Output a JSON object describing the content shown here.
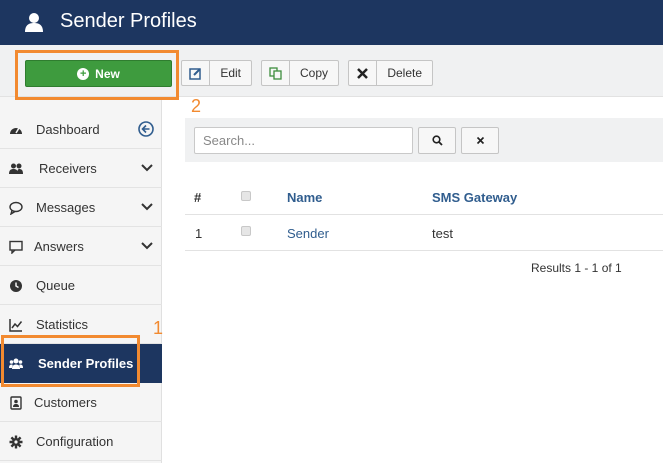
{
  "header": {
    "title": "Sender Profiles",
    "icon": "user-icon"
  },
  "toolbar": {
    "new_label": "New",
    "edit_label": "Edit",
    "copy_label": "Copy",
    "delete_label": "Delete"
  },
  "annotations": {
    "one": "1",
    "two": "2"
  },
  "sidebar": {
    "items": [
      {
        "label": "Dashboard",
        "icon": "dashboard-icon"
      },
      {
        "label": "Receivers",
        "icon": "users-icon"
      },
      {
        "label": "Messages",
        "icon": "message-icon"
      },
      {
        "label": "Answers",
        "icon": "answer-icon"
      },
      {
        "label": "Queue",
        "icon": "clock-icon"
      },
      {
        "label": "Statistics",
        "icon": "chart-icon"
      },
      {
        "label": "Sender Profiles",
        "icon": "group-icon"
      },
      {
        "label": "Customers",
        "icon": "contact-icon"
      },
      {
        "label": "Configuration",
        "icon": "gear-icon"
      }
    ]
  },
  "search": {
    "placeholder": "Search..."
  },
  "table": {
    "columns": [
      "#",
      "Name",
      "SMS Gateway"
    ],
    "rows": [
      {
        "num": "1",
        "name": "Sender",
        "gateway": "test"
      }
    ],
    "results": "Results 1 - 1 of 1"
  },
  "colors": {
    "header": "#1d3660",
    "new_button": "#3e9b3e",
    "highlight": "#f28a30",
    "link": "#305d8e"
  }
}
